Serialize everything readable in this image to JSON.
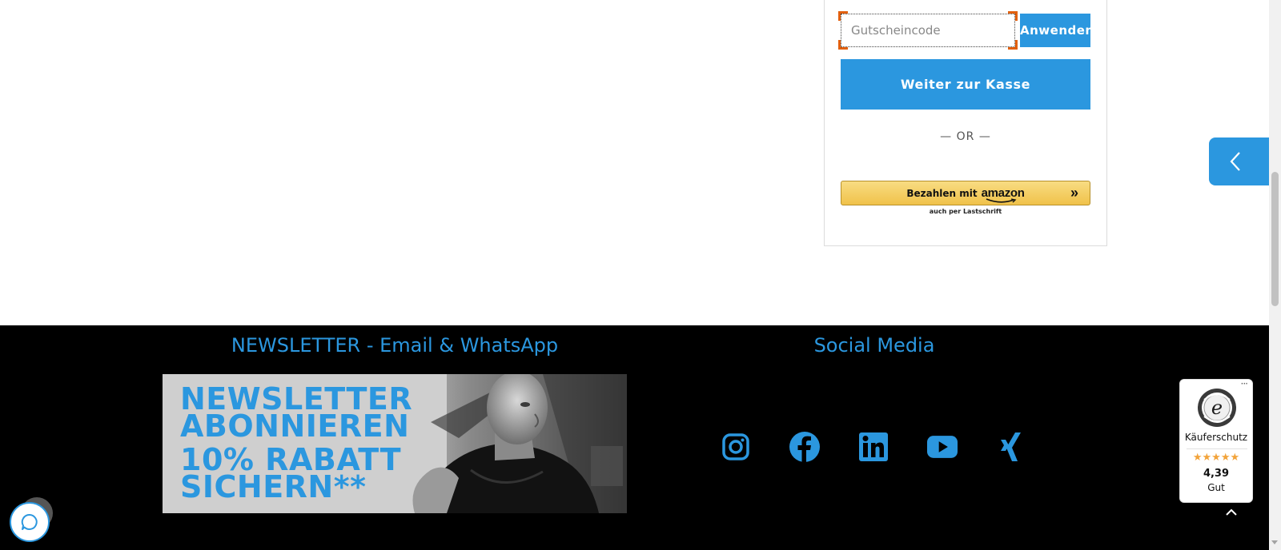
{
  "cart": {
    "coupon_placeholder": "Gutscheincode",
    "coupon_value": "",
    "apply_label": "Anwenden",
    "checkout_label": "Weiter zur Kasse",
    "or_label": "— OR —",
    "amazon_pay_label": "Bezahlen mit",
    "amazon_logo_text": "amazon",
    "amazon_arrows": "»",
    "amazon_sub_label": "auch per Lastschrift"
  },
  "footer": {
    "newsletter_heading": "NEWSLETTER - Email & WhatsApp",
    "social_heading": "Social Media",
    "newsletter_banner": {
      "line1": "NEWSLETTER",
      "line2": "ABONNIEREN",
      "line3": "10% RABATT",
      "line4": "SICHERN**"
    },
    "social_icons": [
      "instagram-icon",
      "facebook-icon",
      "linkedin-icon",
      "youtube-icon",
      "xing-icon"
    ]
  },
  "trust_badge": {
    "title": "Käuferschutz",
    "stars": "★★★★★",
    "rating_value": 4.39,
    "score": "4,39",
    "grade": "Gut",
    "menu": "···"
  },
  "colors": {
    "accent": "#2b97df",
    "footer_bg": "#000000",
    "focus_ring": "#e2600f",
    "amazon_button": "#f0c24a",
    "stars": "#f2a33a"
  }
}
